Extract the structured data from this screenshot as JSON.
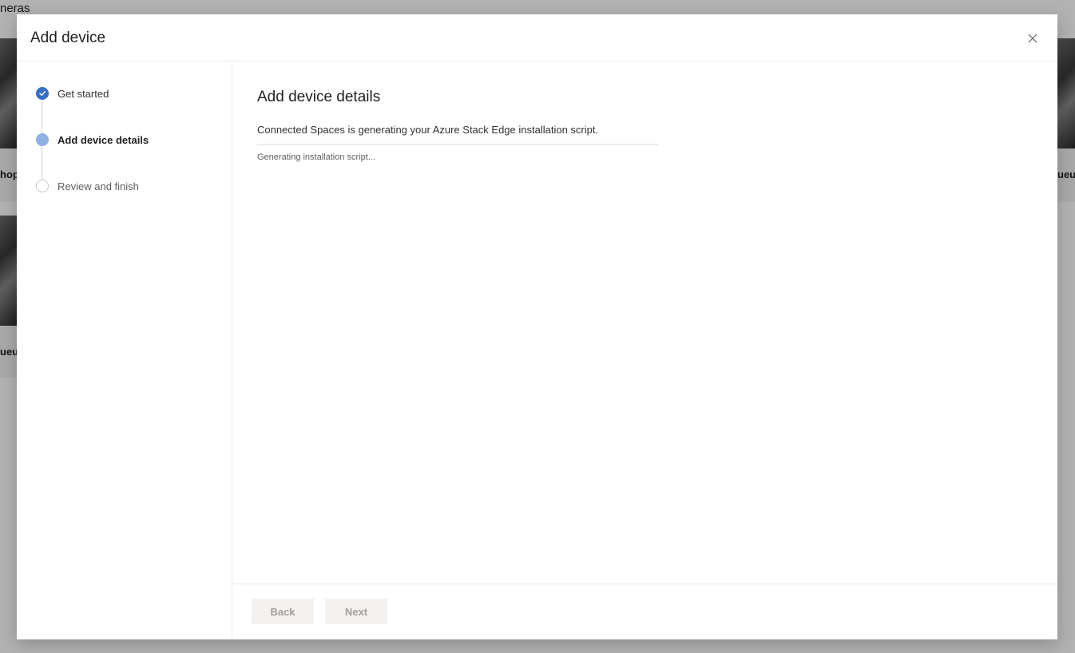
{
  "background": {
    "page_title": "neras",
    "cards": [
      {
        "label": "hopp"
      },
      {
        "label": "ueue"
      },
      {
        "label": "ueue"
      }
    ]
  },
  "dialog": {
    "title": "Add device",
    "close_icon": "close-icon",
    "steps": [
      {
        "label": "Get started",
        "state": "completed"
      },
      {
        "label": "Add device details",
        "state": "current"
      },
      {
        "label": "Review and finish",
        "state": "pending"
      }
    ],
    "content": {
      "heading": "Add device details",
      "description": "Connected Spaces is generating your Azure Stack Edge installation script.",
      "progress_label": "Generating installation script...",
      "progress_fraction": 0.0
    },
    "footer": {
      "back_label": "Back",
      "next_label": "Next"
    }
  },
  "colors": {
    "accent": "#3a6fc4",
    "accent_light": "#8fb0e3",
    "overlay": "#b3b3b3"
  }
}
